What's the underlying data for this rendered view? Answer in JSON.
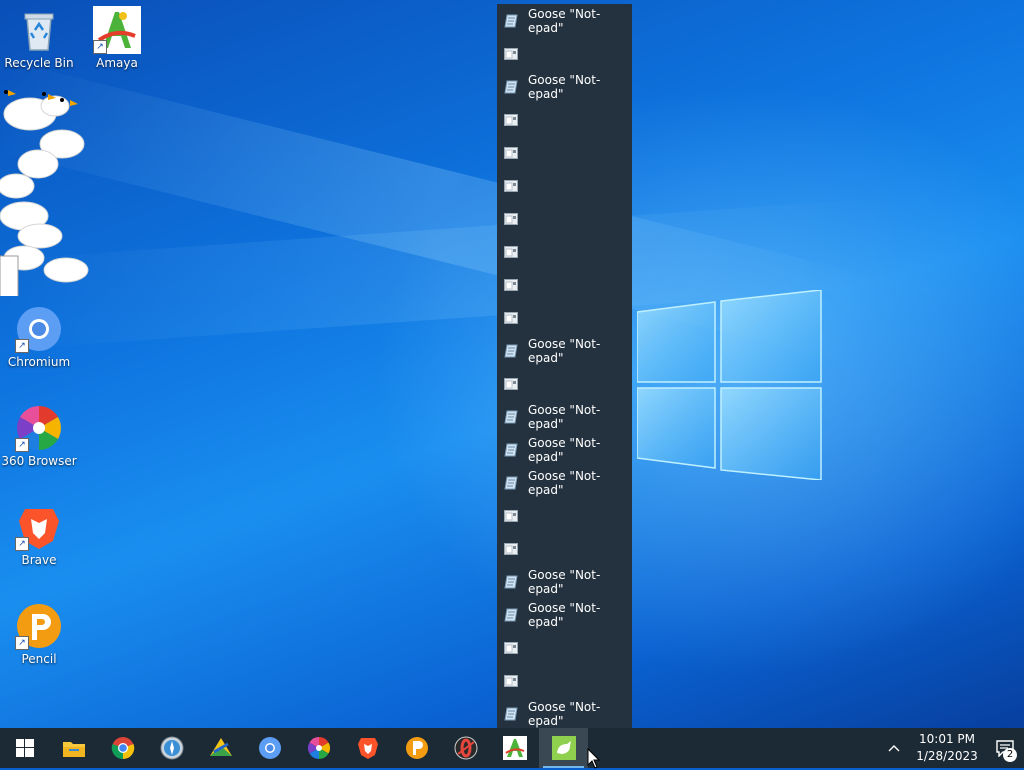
{
  "desktop": {
    "icons": [
      {
        "label": "Recycle Bin",
        "icon": "recycle-bin-icon"
      },
      {
        "label": "Amaya",
        "icon": "amaya-icon"
      },
      {
        "label": "Chromium",
        "icon": "chromium-icon"
      },
      {
        "label": "360 Browser",
        "icon": "360-browser-icon"
      },
      {
        "label": "Brave",
        "icon": "brave-icon"
      },
      {
        "label": "Pencil",
        "icon": "pencil-icon"
      }
    ]
  },
  "jump_list": {
    "items": [
      {
        "label": "Goose \"Not-epad\"",
        "type": "goose-notepad"
      },
      {
        "label": "",
        "type": "window"
      },
      {
        "label": "Goose \"Not-epad\"",
        "type": "goose-notepad"
      },
      {
        "label": "",
        "type": "window"
      },
      {
        "label": "",
        "type": "window"
      },
      {
        "label": "",
        "type": "window"
      },
      {
        "label": "",
        "type": "window"
      },
      {
        "label": "",
        "type": "window"
      },
      {
        "label": "",
        "type": "window"
      },
      {
        "label": "",
        "type": "window"
      },
      {
        "label": "Goose \"Not-epad\"",
        "type": "goose-notepad"
      },
      {
        "label": "",
        "type": "window"
      },
      {
        "label": "Goose \"Not-epad\"",
        "type": "goose-notepad"
      },
      {
        "label": "Goose \"Not-epad\"",
        "type": "goose-notepad"
      },
      {
        "label": "Goose \"Not-epad\"",
        "type": "goose-notepad"
      },
      {
        "label": "",
        "type": "window"
      },
      {
        "label": "",
        "type": "window"
      },
      {
        "label": "Goose \"Not-epad\"",
        "type": "goose-notepad"
      },
      {
        "label": "Goose \"Not-epad\"",
        "type": "goose-notepad"
      },
      {
        "label": "",
        "type": "window"
      },
      {
        "label": "",
        "type": "window"
      },
      {
        "label": "Goose \"Not-epad\"",
        "type": "goose-notepad"
      }
    ]
  },
  "taskbar": {
    "apps": [
      "start-icon",
      "file-explorer-icon",
      "chrome-icon",
      "safari-icon",
      "amaya-taskbar-icon",
      "chromium-taskbar-icon",
      "360-browser-taskbar-icon",
      "brave-taskbar-icon",
      "pencil-taskbar-icon",
      "opera-icon",
      "amaya-a-icon",
      "goose-notepad-icon"
    ],
    "active_app": "goose-notepad-icon",
    "clock_time": "10:01 PM",
    "clock_date": "1/28/2023",
    "notification_count": "2"
  },
  "colors": {
    "taskbar": "#1b2a34",
    "jump_list": "#24323f",
    "accent": "#76b9ed"
  }
}
